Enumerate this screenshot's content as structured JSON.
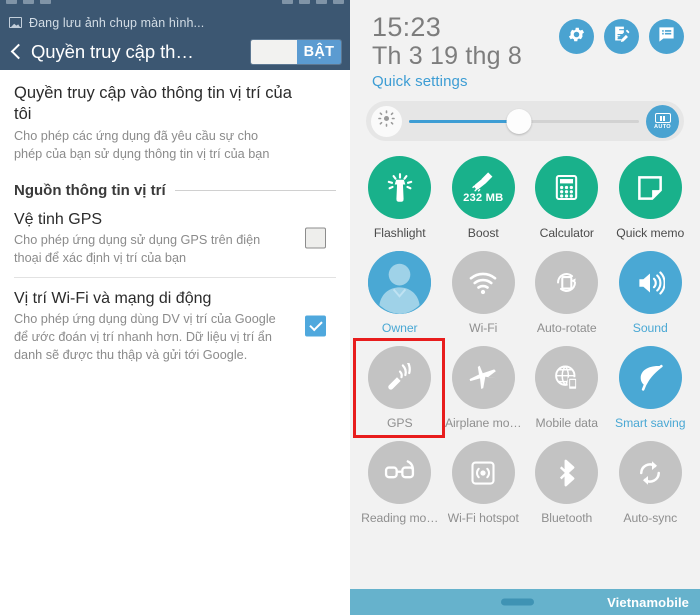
{
  "left_panel": {
    "notification": {
      "icon": "image-icon",
      "text": "Đang lưu ảnh chụp màn hình..."
    },
    "app_bar": {
      "back_icon": "chevron-left-icon",
      "title": "Quyền truy cập th…",
      "toggle_label": "BẬT",
      "toggle_state": "on"
    },
    "intro": {
      "title": "Quyền truy cập vào thông tin vị trí của tôi",
      "description": "Cho phép các ứng dụng đã yêu cầu sự cho phép của bạn sử dụng thông tin vị trí của bạn"
    },
    "section": {
      "header": "Nguồn thông tin vị trí"
    },
    "rows": [
      {
        "title": "Vệ tinh GPS",
        "description": "Cho phép ứng dụng sử dụng GPS trên điện thoại để xác định vị trí của bạn",
        "checked": false
      },
      {
        "title": "Vị trí Wi-Fi và mạng di động",
        "description": "Cho phép ứng dụng dùng DV vị trí của Google để ước đoán vị trí nhanh hơn. Dữ liệu vị trí ẩn danh sẽ được thu thập và gửi tới Google.",
        "checked": true
      }
    ]
  },
  "right_panel": {
    "clock": {
      "time": "15:23",
      "date": "Th 3 19 thg 8",
      "link": "Quick settings"
    },
    "header_icons": [
      {
        "name": "gear-icon"
      },
      {
        "name": "edit-note-icon"
      },
      {
        "name": "message-list-icon"
      }
    ],
    "brightness": {
      "left_icon": "brightness-sun-icon",
      "value_percent": 48,
      "auto_label": "AUTO",
      "auto_icon": "auto-brightness-icon"
    },
    "tiles": [
      {
        "label": "Flashlight",
        "icon": "flashlight-icon",
        "state": "green",
        "sub": ""
      },
      {
        "label": "Boost",
        "icon": "broom-icon",
        "state": "green",
        "sub": "232 MB"
      },
      {
        "label": "Calculator",
        "icon": "calculator-icon",
        "state": "green",
        "sub": ""
      },
      {
        "label": "Quick memo",
        "icon": "memo-icon",
        "state": "green",
        "sub": ""
      },
      {
        "label": "Owner",
        "icon": "user-avatar-icon",
        "state": "blue",
        "sub": ""
      },
      {
        "label": "Wi-Fi",
        "icon": "wifi-icon",
        "state": "gray",
        "sub": ""
      },
      {
        "label": "Auto-rotate",
        "icon": "auto-rotate-icon",
        "state": "gray",
        "sub": ""
      },
      {
        "label": "Sound",
        "icon": "speaker-icon",
        "state": "blue",
        "sub": ""
      },
      {
        "label": "GPS",
        "icon": "gps-satellite-icon",
        "state": "gray",
        "sub": ""
      },
      {
        "label": "Airplane mo…",
        "icon": "airplane-icon",
        "state": "gray",
        "sub": ""
      },
      {
        "label": "Mobile data",
        "icon": "mobile-data-icon",
        "state": "gray",
        "sub": ""
      },
      {
        "label": "Smart saving",
        "icon": "leaf-icon",
        "state": "blue",
        "sub": ""
      },
      {
        "label": "Reading mo…",
        "icon": "glasses-icon",
        "state": "gray",
        "sub": ""
      },
      {
        "label": "Wi-Fi hotspot",
        "icon": "hotspot-icon",
        "state": "gray",
        "sub": ""
      },
      {
        "label": "Bluetooth",
        "icon": "bluetooth-icon",
        "state": "gray",
        "sub": ""
      },
      {
        "label": "Auto-sync",
        "icon": "sync-icon",
        "state": "gray",
        "sub": ""
      }
    ],
    "highlight": {
      "target_label": "GPS",
      "color": "#e81d1d"
    },
    "bottom_bar": {
      "carrier": "Vietnamobile"
    }
  },
  "colors": {
    "header_bg": "#3c5772",
    "accent_blue": "#4aa8d4",
    "accent_green": "#19b18b",
    "inactive_gray": "#c3c3c3",
    "highlight_red": "#e81d1d",
    "bottom_bar": "#66b2cc"
  }
}
